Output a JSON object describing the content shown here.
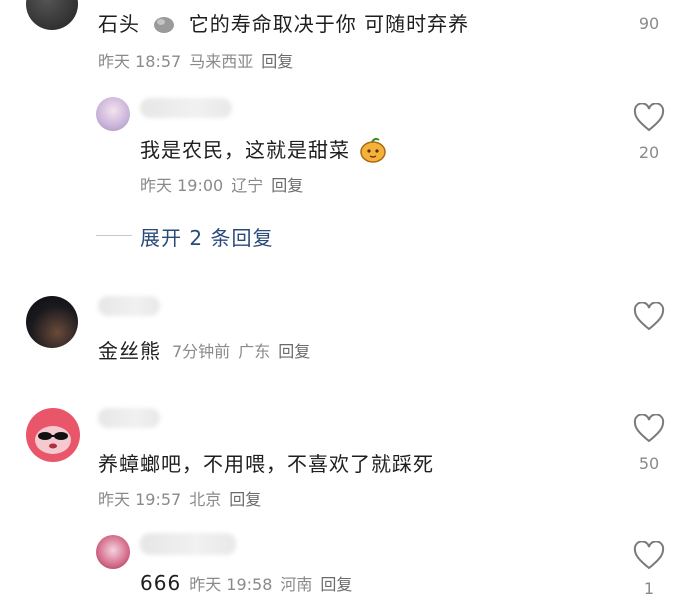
{
  "comments": [
    {
      "text": "石头",
      "text2": "它的寿命取决于你 可随时弃养",
      "time": "昨天 18:57",
      "location": "马来西亚",
      "reply": "回复",
      "likes": "90"
    },
    {
      "text": "我是农民，这就是甜菜",
      "time": "昨天 19:00",
      "location": "辽宁",
      "reply": "回复",
      "likes": "20"
    },
    {
      "text": "金丝熊",
      "time": "7分钟前",
      "location": "广东",
      "reply": "回复",
      "likes": ""
    },
    {
      "text": "养蟑螂吧，不用喂，不喜欢了就踩死",
      "time": "昨天 19:57",
      "location": "北京",
      "reply": "回复",
      "likes": "50"
    },
    {
      "text": "666",
      "time": "昨天 19:58",
      "location": "河南",
      "reply": "回复",
      "likes": "1"
    }
  ],
  "expand_replies": "展开 2 条回复",
  "icons": {
    "heart": "heart-outline-icon",
    "stone": "stone-emoji-icon",
    "sweet": "fruit-emoji-icon"
  },
  "colors": {
    "meta": "#8a8a8a",
    "link": "#2a4a7a"
  }
}
